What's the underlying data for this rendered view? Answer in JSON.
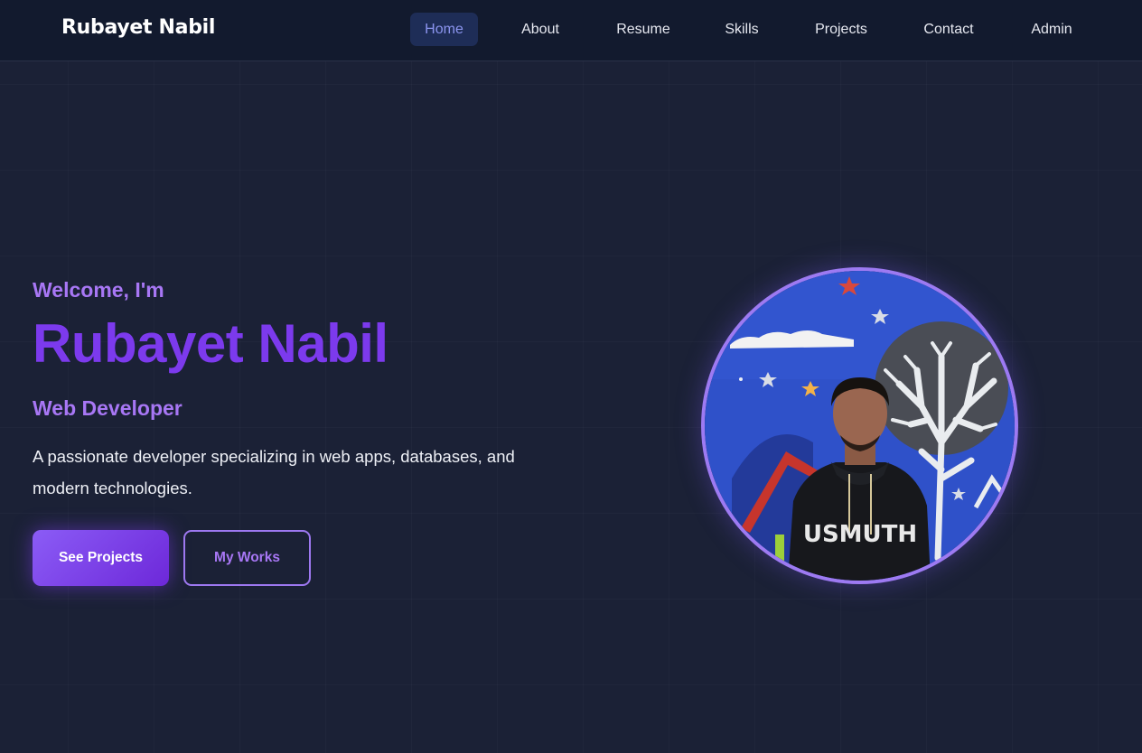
{
  "brand": "Rubayet Nabil",
  "nav": {
    "items": [
      {
        "label": "Home"
      },
      {
        "label": "About"
      },
      {
        "label": "Resume"
      },
      {
        "label": "Skills"
      },
      {
        "label": "Projects"
      },
      {
        "label": "Contact"
      },
      {
        "label": "Admin"
      }
    ],
    "active": "Home"
  },
  "hero": {
    "welcome": "Welcome, I'm",
    "name": "Rubayet Nabil",
    "role": "Web Developer",
    "description": "A passionate developer specializing in web apps, databases, and modern technologies.",
    "primary_button": "See Projects",
    "secondary_button": "My Works",
    "hoodie_text": "USMUTH"
  },
  "colors": {
    "accent": "#7c3aed",
    "accent_light": "#a877f5",
    "background": "#1a2035",
    "navbar": "#121a2e",
    "active_tab_bg": "#1e2d57",
    "active_tab_text": "#8b94ee"
  }
}
